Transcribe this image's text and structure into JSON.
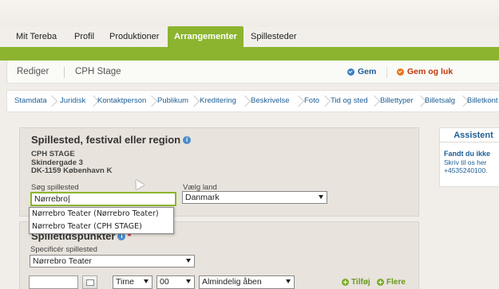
{
  "nav": {
    "items": [
      {
        "label": "Mit Tereba",
        "active": false
      },
      {
        "label": "Profil",
        "active": false
      },
      {
        "label": "Produktioner",
        "active": false
      },
      {
        "label": "Arrangementer",
        "active": true
      },
      {
        "label": "Spillesteder",
        "active": false
      }
    ]
  },
  "toolbar": {
    "edit_label": "Rediger",
    "stage_label": "CPH Stage",
    "save_label": "Gem",
    "save_close_label": "Gem og luk"
  },
  "tabs": [
    "Stamdata",
    "Juridisk",
    "Kontaktperson",
    "Publikum",
    "Kreditering",
    "Beskrivelse",
    "Foto",
    "Tid og sted",
    "Billettyper",
    "Billetsalg",
    "Billetkont"
  ],
  "venue": {
    "title": "Spillested, festival eller region",
    "address": [
      "CPH STAGE",
      "Skindergade 3",
      "DK-1159 København K"
    ],
    "search_label": "Søg spillested",
    "search_value": "Nørrebro",
    "country_label": "Vælg land",
    "country_value": "Danmark"
  },
  "dropdown": {
    "options": [
      "Nørrebro Teater (Nørrebro Teater)",
      "Nørrebro Teater (CPH STAGE)"
    ]
  },
  "times": {
    "title": "Spilletidspunkter",
    "specify_label": "Specificér spillested",
    "specify_value": "Nørrebro Teater",
    "time_value": "Time",
    "minute_value": "00",
    "access_value": "Almindelig åben",
    "add_label": "Tilføj",
    "more_label": "Flere"
  },
  "assistant": {
    "title": "Assistent",
    "line1": "Fandt du ikke",
    "line2_prefix": "Skriv til os ",
    "line2_link": "her",
    "line3": "+4535240100."
  },
  "colors": {
    "accent_green": "#8cb42e",
    "link_blue": "#1d5e94",
    "save_close_orange": "#e8741b"
  }
}
